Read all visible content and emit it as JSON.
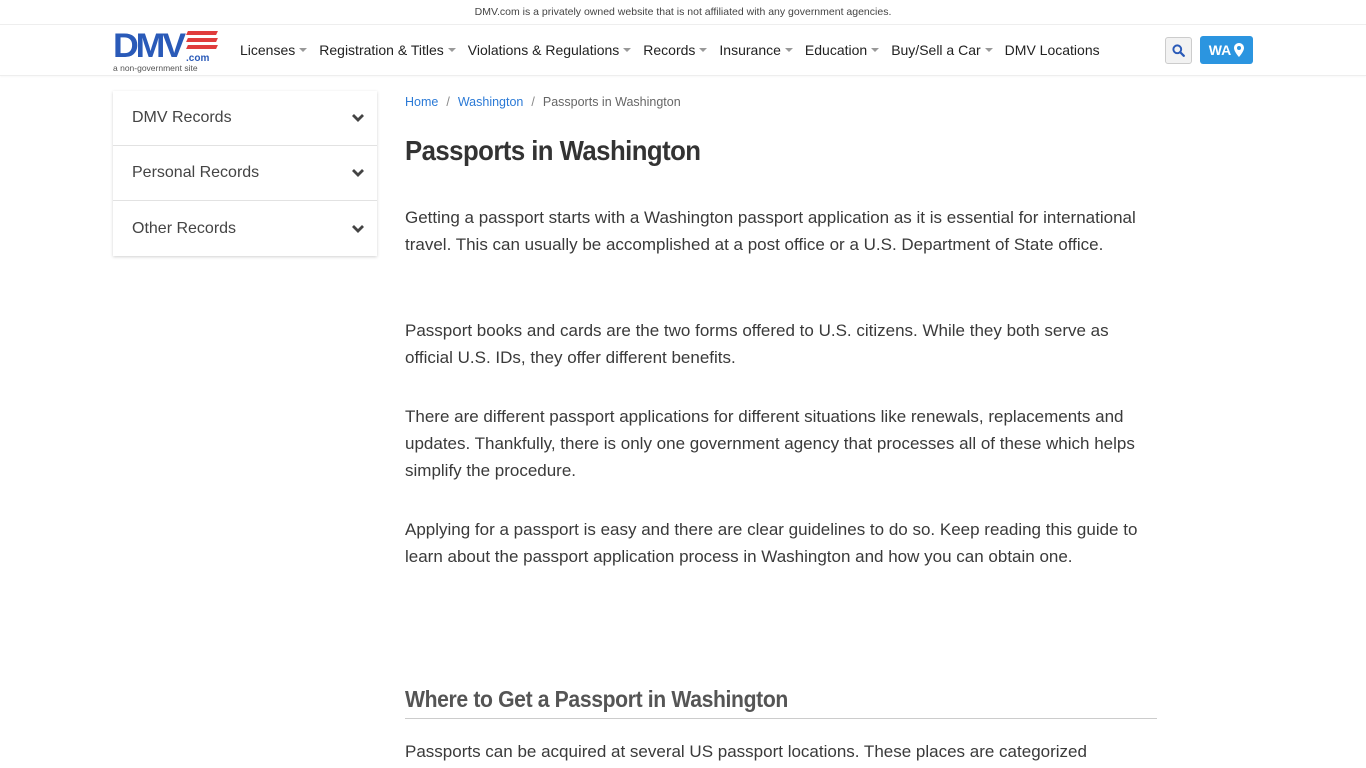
{
  "topbar": {
    "disclaimer": "DMV.com is a privately owned website that is not affiliated with any government agencies."
  },
  "logo": {
    "main": "DMV",
    "suffix": ".com",
    "tagline": "a non-government site"
  },
  "nav": {
    "items": [
      {
        "label": "Licenses",
        "dropdown": true
      },
      {
        "label": "Registration & Titles",
        "dropdown": true
      },
      {
        "label": "Violations & Regulations",
        "dropdown": true
      },
      {
        "label": "Records",
        "dropdown": true
      },
      {
        "label": "Insurance",
        "dropdown": true
      },
      {
        "label": "Education",
        "dropdown": true
      },
      {
        "label": "Buy/Sell a Car",
        "dropdown": true
      },
      {
        "label": "DMV Locations",
        "dropdown": false
      }
    ],
    "search_icon": "search-icon",
    "state_label": "WA",
    "state_icon": "map-marker-icon"
  },
  "colors": {
    "brand_blue": "#2a5ab8",
    "brand_red": "#e03c3c",
    "accent": "#2b95e0",
    "link": "#2b7ad6"
  },
  "sidebar": {
    "items": [
      {
        "label": "DMV Records"
      },
      {
        "label": "Personal Records"
      },
      {
        "label": "Other Records"
      }
    ]
  },
  "breadcrumb": {
    "home": "Home",
    "state": "Washington",
    "current": "Passports in Washington",
    "separator": "/"
  },
  "main": {
    "title": "Passports in Washington",
    "paragraphs": [
      "Getting a passport starts with a Washington passport application as it is essential for international travel. This can usually be accomplished at a post office or a U.S. Department of State office.",
      "Passport books and cards are the two forms offered to U.S. citizens. While they both serve as official U.S. IDs, they offer different benefits.",
      "There are different passport applications for different situations like renewals, replacements and updates. Thankfully, there is only one government agency that processes all of these which helps simplify the procedure.",
      "Applying for a passport is easy and there are clear guidelines to do so. Keep reading this guide to learn about the passport application process in Washington and how you can obtain one."
    ],
    "section_heading": "Where to Get a Passport in Washington",
    "section_paragraph": "Passports can be acquired at several US passport locations. These places are categorized"
  }
}
